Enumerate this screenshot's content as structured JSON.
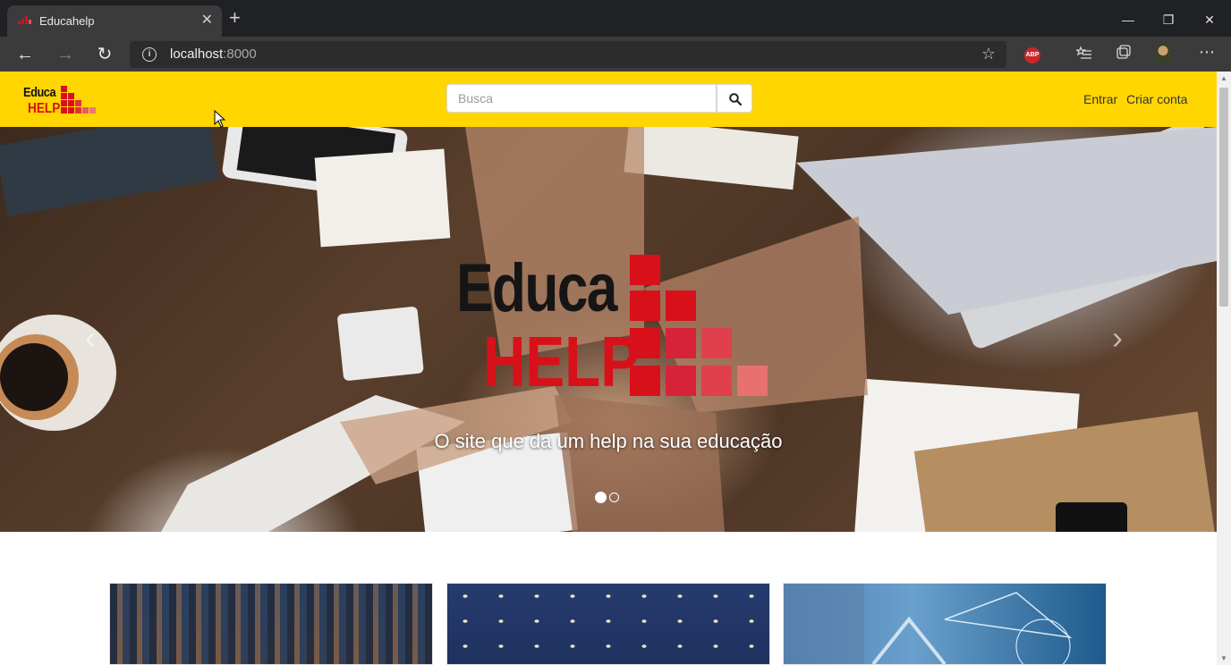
{
  "browser": {
    "tab_title": "Educahelp",
    "new_tab_symbol": "+",
    "close_symbol": "✕",
    "url_host": "localhost",
    "url_port": ":8000",
    "extension_badge": "ABP",
    "window_controls": {
      "minimize": "—",
      "restore": "❐",
      "close": "✕"
    }
  },
  "header": {
    "logo_line1": "Educa",
    "logo_line2": "HELP",
    "search_placeholder": "Busca",
    "login_label": "Entrar",
    "signup_label": "Criar conta",
    "background_color": "#ffd600"
  },
  "hero": {
    "logo_line1": "Educa",
    "logo_line2": "HELP",
    "caption": "O site que da um help na sua educação",
    "prev_symbol": "‹",
    "next_symbol": "›",
    "slide_count": 2,
    "active_slide": 1
  },
  "cards": [
    {
      "image": "electronics-circuit-board"
    },
    {
      "image": "american-flag-stars"
    },
    {
      "image": "math-blueprint"
    }
  ],
  "colors": {
    "brand_red": "#d8101a",
    "brand_yellow": "#ffd600"
  }
}
